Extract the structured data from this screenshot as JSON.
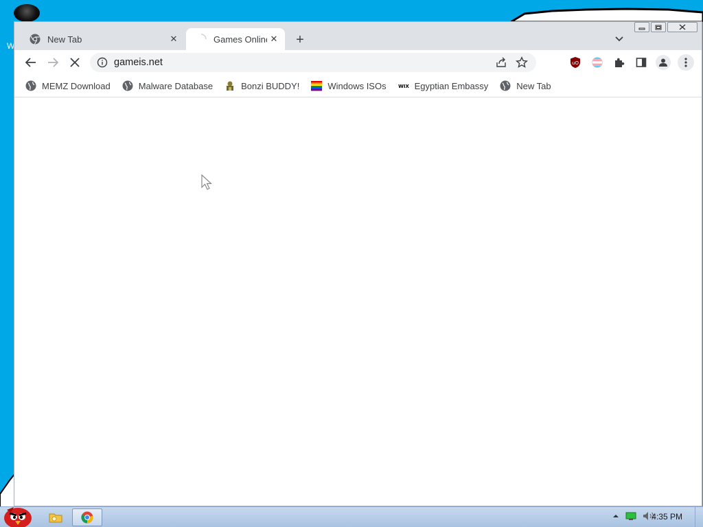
{
  "window": {
    "tabs": [
      {
        "title": "New Tab",
        "active": false
      },
      {
        "title": "Games Online",
        "active": true
      }
    ],
    "new_tab_glyph": "+",
    "close_glyph": "✕"
  },
  "toolbar": {
    "url": "gameis.net",
    "loading": true
  },
  "bookmarks": [
    {
      "label": "MEMZ Download",
      "icon": "globe-icon"
    },
    {
      "label": "Malware Database",
      "icon": "globe-icon"
    },
    {
      "label": "Bonzi BUDDY!",
      "icon": "bonzi-icon"
    },
    {
      "label": "Windows ISOs",
      "icon": "rainbow-flag-icon"
    },
    {
      "label": "Egyptian Embassy",
      "icon": "wix-icon"
    },
    {
      "label": "New Tab",
      "icon": "globe-icon"
    }
  ],
  "desktop": {
    "partial_letter": "W"
  },
  "taskbar": {
    "clock": "4:35 PM"
  },
  "colors": {
    "desktop": "#00a8e8",
    "accent": "#1a73e8",
    "ublock": "#800000"
  }
}
